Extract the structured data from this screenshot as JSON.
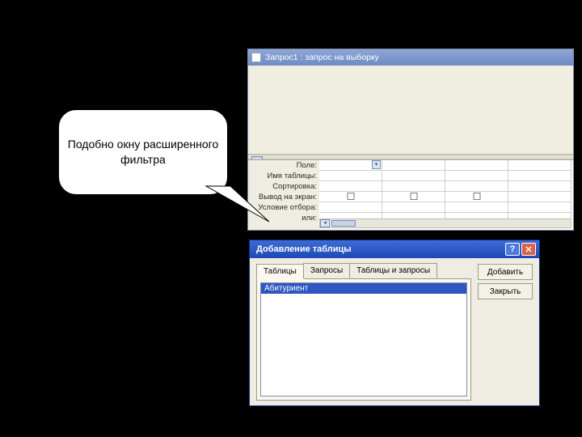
{
  "callout": {
    "text": "Подобно окну расширенного фильтра"
  },
  "query_window": {
    "title": "Запрос1 : запрос на выборку",
    "row_labels": [
      "Поле:",
      "Имя таблицы:",
      "Сортировка:",
      "Вывод на экран:",
      "Условие отбора:",
      "или:"
    ]
  },
  "add_table_dialog": {
    "title": "Добавление таблицы",
    "tabs": [
      "Таблицы",
      "Запросы",
      "Таблицы и запросы"
    ],
    "active_tab": 0,
    "list_items": [
      "Абитуриент"
    ],
    "buttons": {
      "add": "Добавить",
      "close": "Закрыть"
    },
    "help_glyph": "?",
    "close_glyph": "✕"
  }
}
